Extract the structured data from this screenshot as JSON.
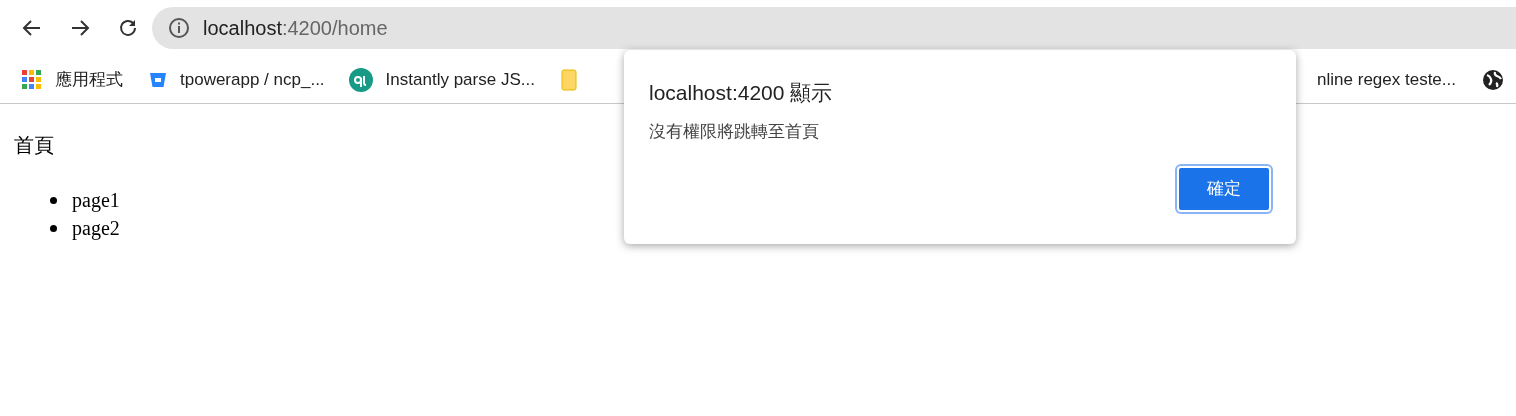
{
  "browser": {
    "url_host": "localhost",
    "url_rest": ":4200/home"
  },
  "bookmarks": [
    {
      "kind": "apps",
      "label": "應用程式"
    },
    {
      "kind": "bucket",
      "label": "tpowerapp / ncp_..."
    },
    {
      "kind": "qt",
      "label": "Instantly parse JS..."
    },
    {
      "kind": "folder"
    },
    {
      "kind": "text",
      "label": "nline regex teste..."
    },
    {
      "kind": "globe"
    }
  ],
  "page": {
    "heading": "首頁",
    "links": [
      "page1",
      "page2"
    ]
  },
  "dialog": {
    "title": "localhost:4200 顯示",
    "message": "沒有權限將跳轉至首頁",
    "button": "確定"
  }
}
